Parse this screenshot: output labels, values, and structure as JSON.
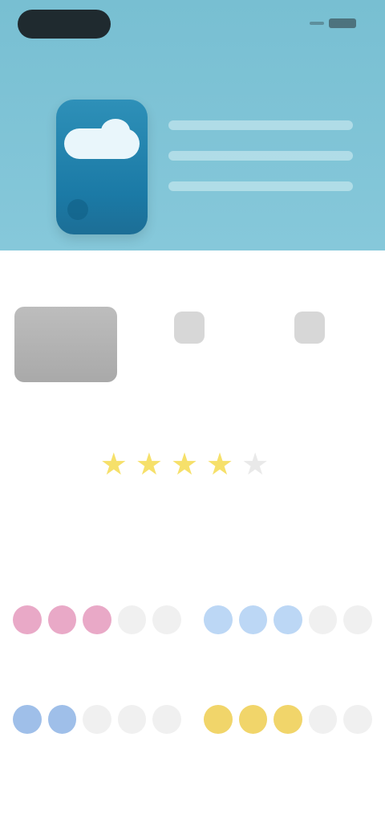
{
  "hero": {
    "title": "",
    "subtitle": "",
    "tagline": ""
  },
  "sections": {
    "label": "",
    "mini1_caption": "",
    "mini2_caption": ""
  },
  "rating": {
    "stars_filled": 4,
    "stars_total": 5,
    "score": "",
    "caption": ""
  },
  "categories": [
    {
      "title": "",
      "filled": 3,
      "total": 5,
      "color": "#e9a9c7"
    },
    {
      "title": "",
      "filled": 3,
      "total": 5,
      "color": "#bcd7f5"
    },
    {
      "title": "",
      "filled": 2,
      "total": 5,
      "color": "#9fbfe9"
    },
    {
      "title": "",
      "filled": 3,
      "total": 5,
      "color": "#f1d56a"
    }
  ],
  "footer": {
    "text": ""
  },
  "colors": {
    "hero_bg": "#78bfd2",
    "app_icon_bg": "#2e90b8"
  },
  "icons": {
    "app_icon": "cloud-drop-icon",
    "mini1": "clock-icon",
    "mini2": "dashboard-icon"
  }
}
